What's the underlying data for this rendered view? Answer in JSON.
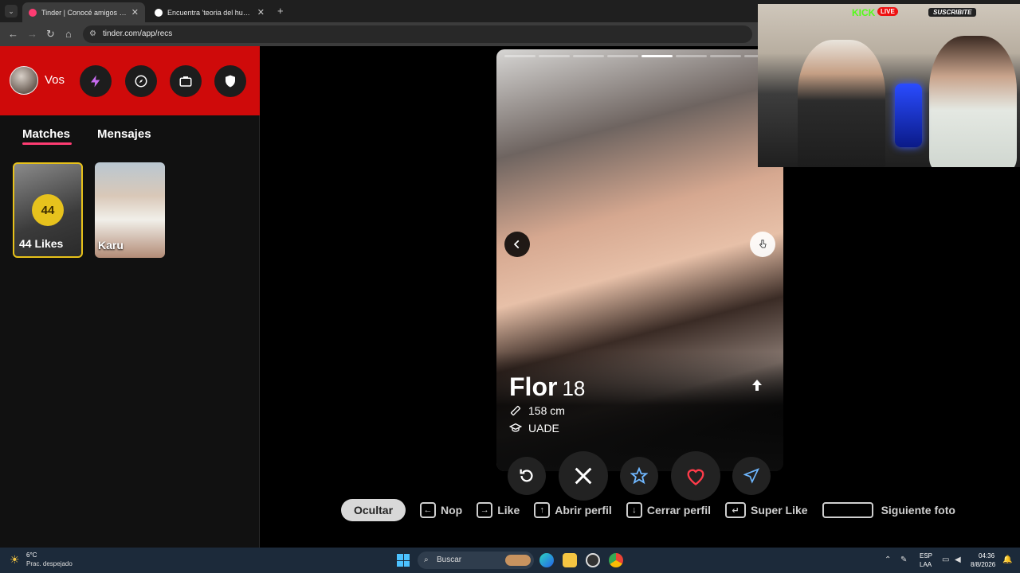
{
  "browser": {
    "tabs": [
      {
        "title": "Tinder | Conocé amigos y gente",
        "active": true
      },
      {
        "title": "Encuentra 'teoria del huevo' en",
        "active": false
      }
    ],
    "url": "tinder.com/app/recs"
  },
  "sidebar": {
    "user_label": "Vos",
    "tabs": {
      "matches": "Matches",
      "messages": "Mensajes"
    },
    "likes": {
      "count": "44",
      "label": "44 Likes"
    },
    "matches": [
      {
        "name": "Karu"
      }
    ]
  },
  "profile": {
    "name": "Flor",
    "age": "18",
    "height": "158 cm",
    "school": "UADE",
    "photo_count": 8,
    "current_photo": 5
  },
  "shortcuts": {
    "hide": "Ocultar",
    "items": [
      {
        "key": "←",
        "label": "Nop"
      },
      {
        "key": "→",
        "label": "Like"
      },
      {
        "key": "↑",
        "label": "Abrir perfil"
      },
      {
        "key": "↓",
        "label": "Cerrar perfil"
      },
      {
        "key": "↵",
        "label": "Super Like"
      },
      {
        "key": "",
        "label": "Siguiente foto"
      }
    ]
  },
  "stream_overlay": {
    "platform": "KICK",
    "live": "LIVE",
    "subscribe": "SUSCRIBITE"
  },
  "taskbar": {
    "temperature": "6°C",
    "weather": "Prac. despejado",
    "search": "Buscar",
    "lang1": "ESP",
    "lang2": "LAA",
    "time": "04:36",
    "date": "8/8/2026"
  },
  "colors": {
    "tinder_red": "#cf0a0a",
    "accent_pink": "#fe3c72",
    "gold": "#e7c21d",
    "kick_green": "#53fc18"
  }
}
